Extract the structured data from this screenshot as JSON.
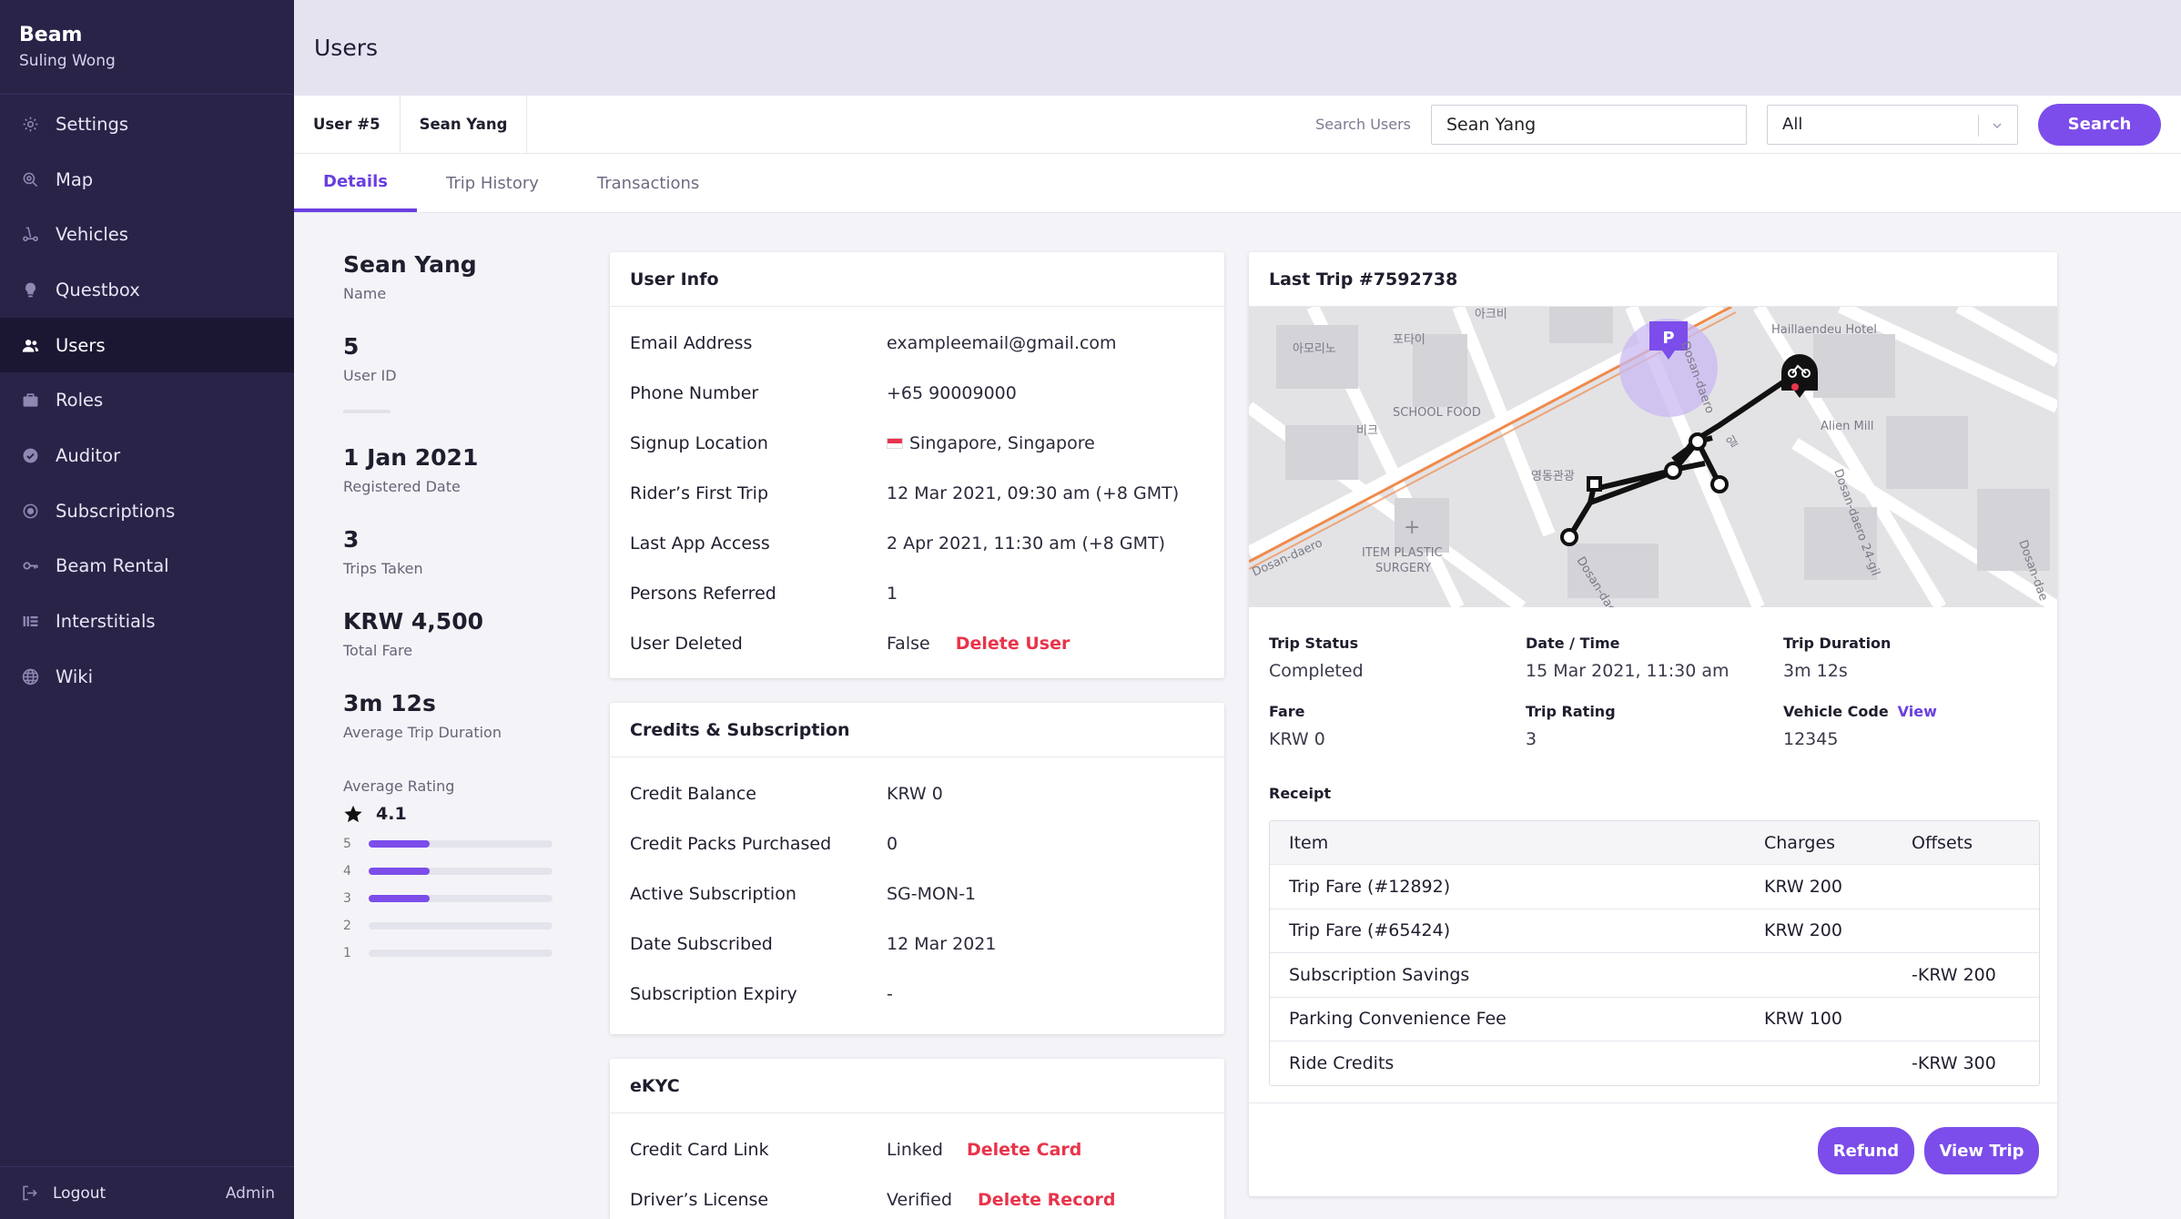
{
  "app": {
    "name": "Beam",
    "user": "Suling Wong"
  },
  "nav": {
    "items": [
      {
        "label": "Settings",
        "icon": "gear-icon"
      },
      {
        "label": "Map",
        "icon": "map-search-icon"
      },
      {
        "label": "Vehicles",
        "icon": "scooter-icon"
      },
      {
        "label": "Questbox",
        "icon": "bulb-icon"
      },
      {
        "label": "Users",
        "icon": "users-icon"
      },
      {
        "label": "Roles",
        "icon": "briefcase-icon"
      },
      {
        "label": "Auditor",
        "icon": "badge-check-icon"
      },
      {
        "label": "Subscriptions",
        "icon": "circle-dot-icon"
      },
      {
        "label": "Beam Rental",
        "icon": "key-icon"
      },
      {
        "label": "Interstitials",
        "icon": "list-icon"
      },
      {
        "label": "Wiki",
        "icon": "globe-icon"
      }
    ],
    "active_index": 4
  },
  "footer": {
    "logout": "Logout",
    "role": "Admin"
  },
  "page": {
    "title": "Users"
  },
  "crumbs": {
    "user_id": "User #5",
    "user_name": "Sean Yang"
  },
  "search": {
    "label": "Search Users",
    "value": "Sean Yang",
    "filter": "All",
    "button": "Search"
  },
  "tabs": {
    "details": "Details",
    "trip_history": "Trip History",
    "transactions": "Transactions"
  },
  "profile": {
    "name": "Sean Yang",
    "name_label": "Name",
    "user_id": "5",
    "user_id_label": "User ID",
    "registered": "1 Jan 2021",
    "registered_label": "Registered Date",
    "trips": "3",
    "trips_label": "Trips Taken",
    "fare": "KRW 4,500",
    "fare_label": "Total Fare",
    "avg_duration": "3m 12s",
    "avg_duration_label": "Average Trip Duration",
    "rating_label": "Average Rating",
    "rating": "4.1",
    "rating_bars": [
      {
        "n": "5",
        "fraction": 0.33
      },
      {
        "n": "4",
        "fraction": 0.33
      },
      {
        "n": "3",
        "fraction": 0.33
      },
      {
        "n": "2",
        "fraction": 0.0
      },
      {
        "n": "1",
        "fraction": 0.0
      }
    ]
  },
  "user_info": {
    "title": "User Info",
    "email_k": "Email Address",
    "email_v": "exampleemail@gmail.com",
    "phone_k": "Phone Number",
    "phone_v": "+65 90009000",
    "signup_k": "Signup Location",
    "signup_v": "Singapore, Singapore",
    "first_k": "Rider’s First Trip",
    "first_v": "12 Mar 2021, 09:30 am (+8 GMT)",
    "last_k": "Last App Access",
    "last_v": "2 Apr 2021, 11:30 am (+8 GMT)",
    "ref_k": "Persons Referred",
    "ref_v": "1",
    "del_k": "User Deleted",
    "del_v": "False",
    "del_action": "Delete User"
  },
  "credits": {
    "title": "Credits & Subscription",
    "bal_k": "Credit Balance",
    "bal_v": "KRW 0",
    "packs_k": "Credit Packs Purchased",
    "packs_v": "0",
    "sub_k": "Active Subscription",
    "sub_v": "SG-MON-1",
    "date_k": "Date Subscribed",
    "date_v": "12 Mar 2021",
    "exp_k": "Subscription Expiry",
    "exp_v": "-"
  },
  "ekyc": {
    "title": "eKYC",
    "card_k": "Credit Card Link",
    "card_v": "Linked",
    "card_action": "Delete Card",
    "lic_k": "Driver’s License",
    "lic_v": "Verified",
    "lic_action": "Delete Record"
  },
  "trip": {
    "title": "Last Trip #7592738",
    "status_k": "Trip Status",
    "status_v": "Completed",
    "date_k": "Date / Time",
    "date_v": "15 Mar 2021, 11:30 am",
    "dur_k": "Trip Duration",
    "dur_v": "3m 12s",
    "fare_k": "Fare",
    "fare_v": "KRW 0",
    "rating_k": "Trip Rating",
    "rating_v": "3",
    "veh_k": "Vehicle Code",
    "veh_link": "View",
    "veh_v": "12345",
    "receipt_title": "Receipt",
    "receipt_head": {
      "item": "Item",
      "charges": "Charges",
      "offsets": "Offsets"
    },
    "receipt_rows": [
      {
        "item": "Trip Fare (#12892)",
        "charges": "KRW 200",
        "offsets": ""
      },
      {
        "item": "Trip Fare (#65424)",
        "charges": "KRW 200",
        "offsets": ""
      },
      {
        "item": "Subscription Savings",
        "charges": "",
        "offsets": "-KRW 200"
      },
      {
        "item": "Parking Convenience Fee",
        "charges": "KRW 100",
        "offsets": ""
      },
      {
        "item": "Ride Credits",
        "charges": "",
        "offsets": "-KRW 300"
      }
    ],
    "refund": "Refund",
    "view_trip": "View Trip",
    "map_labels": {
      "hotel": "Haillaendeu Hotel",
      "mill": "Alien Mill",
      "school_food": "SCHOOL FOOD",
      "surgery1": "ITEM PLASTIC",
      "surgery2": "SURGERY",
      "road1": "Dosan-daero",
      "road2": "Dosan-daero 24-gil",
      "road3": "Dosan-dae",
      "road4": "Dosan-dae",
      "road5": "Dosan-daero",
      "k1": "아모리노",
      "k2": "포타이",
      "k3": "아크비",
      "k4": "영동관광",
      "k5": "일",
      "k6": "비크",
      "p_marker": "P"
    },
    "colors": {
      "accent": "#7c4dea",
      "route": "#111111",
      "danger": "#e8344b"
    }
  }
}
